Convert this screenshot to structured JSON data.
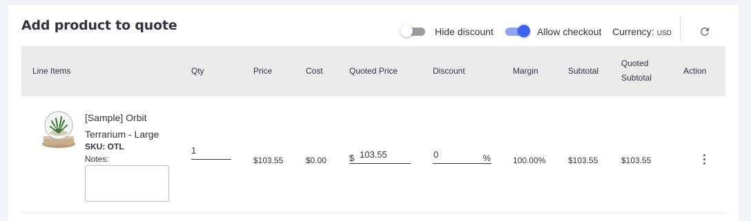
{
  "header": {
    "title": "Add product to quote",
    "hide_discount_label": "Hide discount",
    "hide_discount_on": false,
    "allow_checkout_label": "Allow checkout",
    "allow_checkout_on": true,
    "currency_label": "Currency:",
    "currency_code": "USD",
    "refresh_icon": "refresh-icon"
  },
  "table": {
    "columns": {
      "line_items": "Line Items",
      "qty": "Qty",
      "price": "Price",
      "cost": "Cost",
      "quoted_price": "Quoted Price",
      "discount": "Discount",
      "margin": "Margin",
      "subtotal": "Subtotal",
      "quoted_subtotal_line1": "Quoted",
      "quoted_subtotal_line2": "Subtotal",
      "action": "Action"
    },
    "rows": [
      {
        "name": "[Sample] Orbit Terrarium - Large",
        "sku": "SKU: OTL",
        "notes_label": "Notes:",
        "notes_value": "",
        "qty": "1",
        "price": "$103.55",
        "cost": "$0.00",
        "quoted_price_prefix": "$",
        "quoted_price": "103.55",
        "discount": "0",
        "discount_suffix": "%",
        "margin": "100.00%",
        "subtotal": "$103.55",
        "quoted_subtotal": "$103.55",
        "action_icon": "more-vertical-icon"
      }
    ]
  },
  "colors": {
    "accent": "#3c64f4",
    "header_bg": "#ebebeb",
    "text": "#313440"
  }
}
